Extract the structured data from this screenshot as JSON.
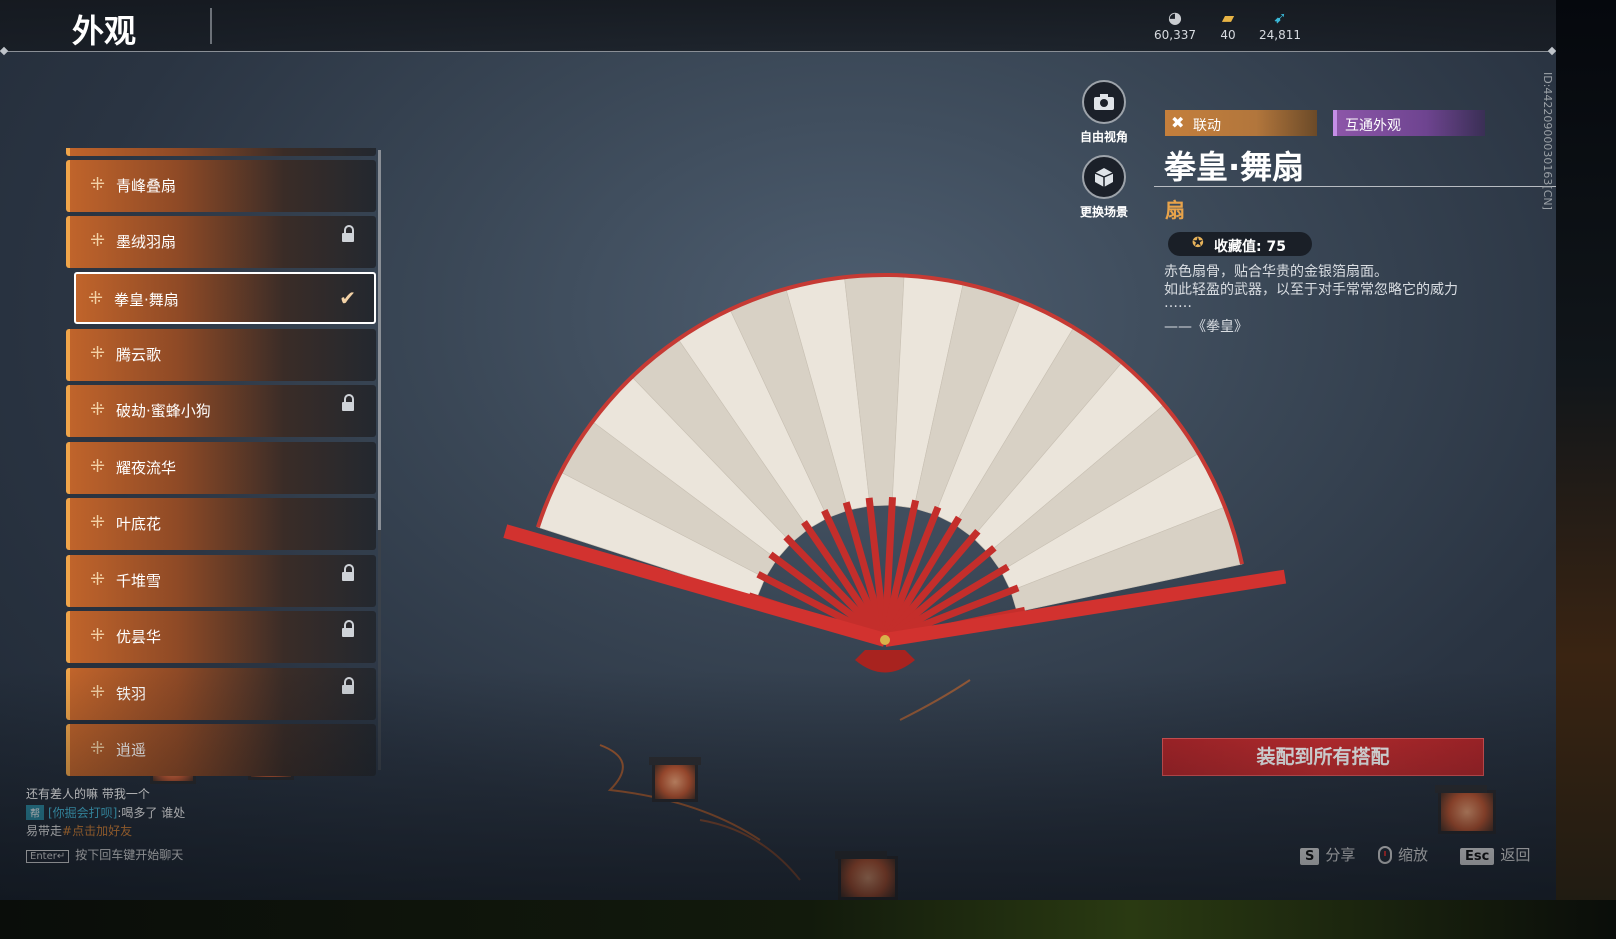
{
  "header": {
    "title": "外观",
    "currencies": [
      {
        "icon": "coin-icon",
        "value": "60,337"
      },
      {
        "icon": "ticket-icon",
        "value": "40"
      },
      {
        "icon": "feather-icon",
        "value": "24,811"
      }
    ]
  },
  "list": {
    "items": [
      {
        "label": "青峰叠扇",
        "locked": false,
        "selected": false
      },
      {
        "label": "墨绒羽扇",
        "locked": true,
        "selected": false
      },
      {
        "label": "拳皇·舞扇",
        "locked": false,
        "selected": true
      },
      {
        "label": "腾云歌",
        "locked": false,
        "selected": false
      },
      {
        "label": "破劫·蜜蜂小狗",
        "locked": true,
        "selected": false
      },
      {
        "label": "耀夜流华",
        "locked": false,
        "selected": false
      },
      {
        "label": "叶底花",
        "locked": false,
        "selected": false
      },
      {
        "label": "千堆雪",
        "locked": true,
        "selected": false
      },
      {
        "label": "优昙华",
        "locked": true,
        "selected": false
      },
      {
        "label": "铁羽",
        "locked": true,
        "selected": false
      },
      {
        "label": "逍遥",
        "locked": false,
        "selected": false
      }
    ]
  },
  "camera": {
    "free_view": "自由视角",
    "change_scene": "更换场景"
  },
  "detail": {
    "tag_collab": "联动",
    "tag_shared": "互通外观",
    "name": "拳皇·舞扇",
    "type": "扇",
    "collect_label": "收藏值: 75",
    "desc_line1": "赤色扇骨，贴合华贵的金银箔扇面。",
    "desc_line2": "如此轻盈的武器，以至于对手常常忽略它的威力",
    "desc_line3": "……",
    "desc_source": "——《拳皇》",
    "equip_button": "装配到所有搭配",
    "id_text": "ID:4422090003016​3[CN]"
  },
  "chat": {
    "line1": "还有差人的嘛 带我一个",
    "line2_tag": "帮",
    "line2_name": "[你掘会打呗]",
    "line2_text": ":喝多了 谁处",
    "line3_text": "易带走",
    "line3_link": "#点击加好友",
    "enter_key": "Enter↵",
    "hint": "按下回车键开始聊天"
  },
  "hotkeys": {
    "share_key": "S",
    "share_label": "分享",
    "zoom_label": "缩放",
    "back_key": "Esc",
    "back_label": "返回"
  },
  "colors": {
    "accent_orange": "#e8a34a",
    "equip_red": "#cf2f31",
    "collab_tag": "#c47f3c",
    "shared_tag": "#8c56a8"
  }
}
